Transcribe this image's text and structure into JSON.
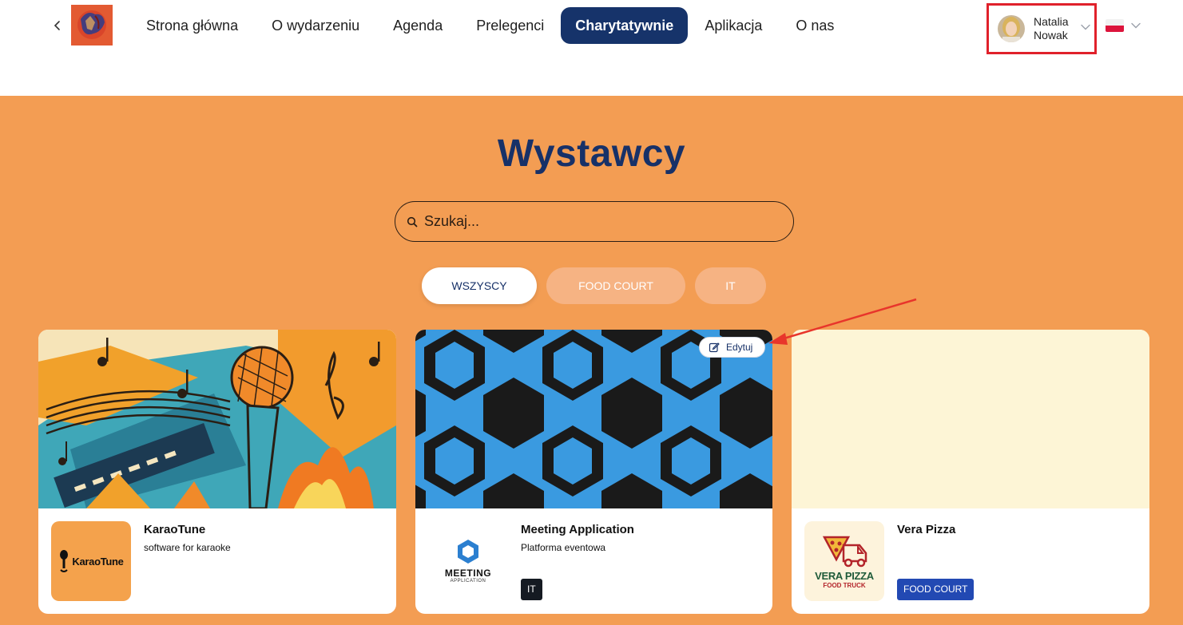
{
  "header": {
    "nav": [
      {
        "label": "Strona główna",
        "active": false
      },
      {
        "label": "O wydarzeniu",
        "active": false
      },
      {
        "label": "Agenda",
        "active": false
      },
      {
        "label": "Prelegenci",
        "active": false
      },
      {
        "label": "Charytatywnie",
        "active": true
      },
      {
        "label": "Aplikacja",
        "active": false
      },
      {
        "label": "O nas",
        "active": false
      }
    ],
    "user": {
      "first_name": "Natalia",
      "last_name": "Nowak"
    },
    "language_icon": "poland-flag-icon"
  },
  "main": {
    "title": "Wystawcy",
    "search": {
      "placeholder": "Szukaj...",
      "value": ""
    },
    "filters": [
      {
        "label": "WSZYSCY",
        "active": true
      },
      {
        "label": "FOOD COURT",
        "active": false
      },
      {
        "label": "IT",
        "active": false
      }
    ],
    "cards": [
      {
        "name": "KaraoTune",
        "description": "software for karaoke",
        "logo_text": "KaraoTune",
        "tag": ""
      },
      {
        "name": "Meeting Application",
        "description": "Platforma eventowa",
        "logo_text": "MEETING",
        "logo_subtext": "APPLICATION",
        "tag": "IT",
        "edit_label": "Edytuj"
      },
      {
        "name": "Vera Pizza",
        "description": "",
        "logo_text": "VERA PIZZA",
        "logo_subtext": "FOOD TRUCK",
        "tag": "FOOD COURT"
      }
    ]
  },
  "colors": {
    "brand_navy": "#16336a",
    "background_orange": "#f39d53",
    "highlight_red": "#e0212b",
    "tag_food_court": "#2249b3",
    "tag_it": "#151a22"
  }
}
